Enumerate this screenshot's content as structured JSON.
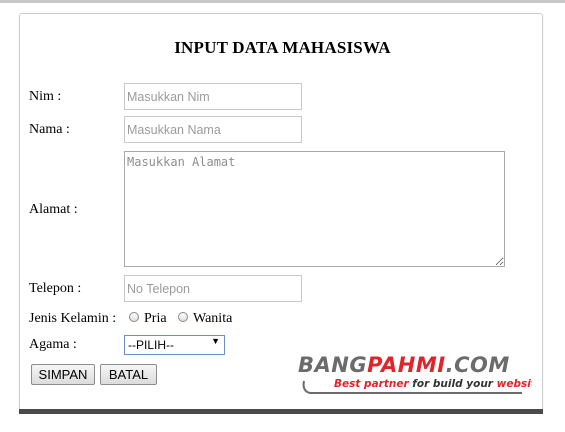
{
  "form": {
    "title": "INPUT DATA MAHASISWA",
    "nim": {
      "label": "Nim :",
      "placeholder": "Masukkan Nim",
      "value": ""
    },
    "nama": {
      "label": "Nama :",
      "placeholder": "Masukkan Nama",
      "value": ""
    },
    "alamat": {
      "label": "Alamat :",
      "placeholder": "Masukkan Alamat",
      "value": ""
    },
    "telepon": {
      "label": "Telepon :",
      "placeholder": "No Telepon",
      "value": ""
    },
    "jenis_kelamin": {
      "label": "Jenis Kelamin :",
      "options": [
        "Pria",
        "Wanita"
      ],
      "selected": null
    },
    "agama": {
      "label": "Agama :",
      "selected": "--PILIH--"
    },
    "buttons": {
      "save": "SIMPAN",
      "cancel": "BATAL"
    }
  },
  "watermark": {
    "brand_part1": "BANG",
    "brand_part2": "PAHMI",
    "brand_part3": ".COM",
    "tagline_part1": "Best partner",
    "tagline_part2": "for build your",
    "tagline_part3": "website",
    "colors": {
      "brand_gray": "#6b6b6b",
      "brand_red": "#e0242b",
      "outline": "#ffffff"
    }
  }
}
